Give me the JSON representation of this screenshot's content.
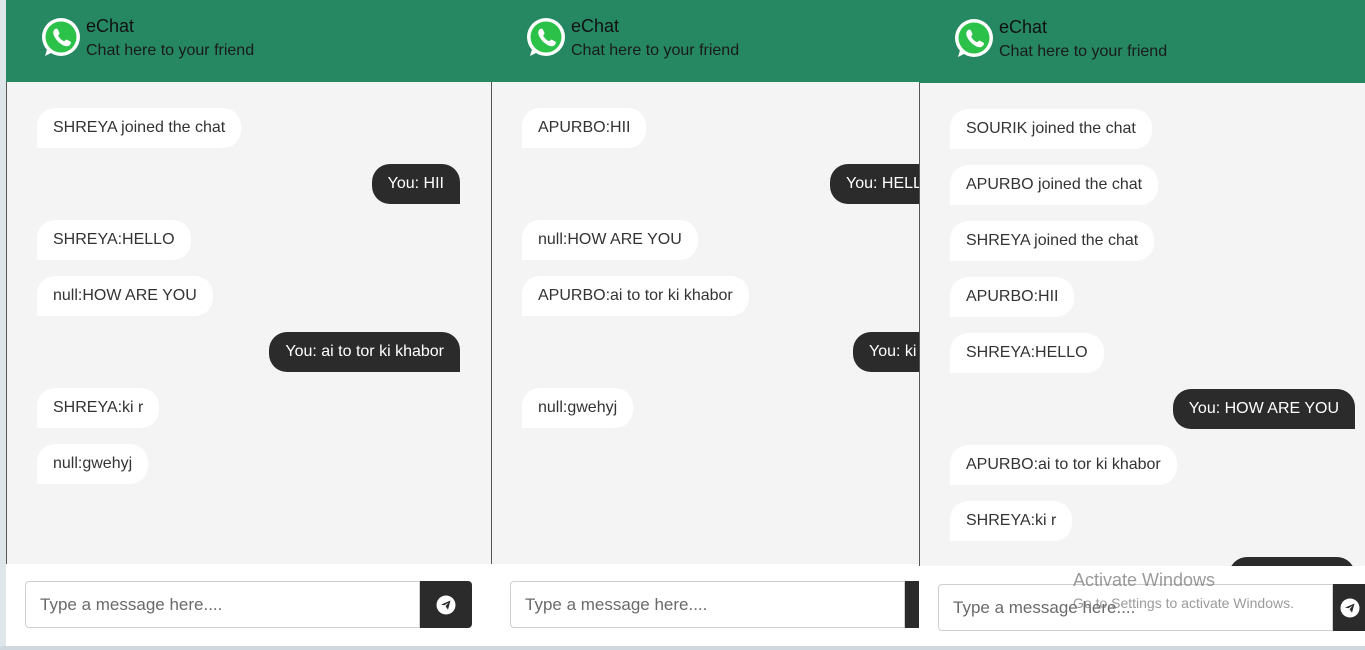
{
  "app": {
    "title": "eChat",
    "subtitle": "Chat here to your friend"
  },
  "colors": {
    "header": "#268763",
    "outgoing": "#2b2b2b",
    "incoming": "#ffffff",
    "background": "#f4f4f4"
  },
  "icons": {
    "logo": "whatsapp-icon",
    "send": "send-icon"
  },
  "panels": [
    {
      "messages": [
        {
          "text": "SHREYA joined the chat",
          "dir": "in"
        },
        {
          "text": "You: HII",
          "dir": "out"
        },
        {
          "text": "SHREYA:HELLO",
          "dir": "in"
        },
        {
          "text": "null:HOW ARE YOU",
          "dir": "in"
        },
        {
          "text": "You: ai to tor ki khabor",
          "dir": "out"
        },
        {
          "text": "SHREYA:ki r",
          "dir": "in"
        },
        {
          "text": "null:gwehyj",
          "dir": "in"
        }
      ],
      "input_placeholder": "Type a message here...."
    },
    {
      "messages": [
        {
          "text": "APURBO:HII",
          "dir": "in"
        },
        {
          "text": "You: HELLO",
          "dir": "out"
        },
        {
          "text": "null:HOW ARE YOU",
          "dir": "in"
        },
        {
          "text": "APURBO:ai to tor ki khabor",
          "dir": "in"
        },
        {
          "text": "You: ki r",
          "dir": "out"
        },
        {
          "text": "null:gwehyj",
          "dir": "in"
        }
      ],
      "input_placeholder": "Type a message here...."
    },
    {
      "messages": [
        {
          "text": "SOURIK joined the chat",
          "dir": "in"
        },
        {
          "text": "APURBO joined the chat",
          "dir": "in"
        },
        {
          "text": "SHREYA joined the chat",
          "dir": "in"
        },
        {
          "text": "APURBO:HII",
          "dir": "in"
        },
        {
          "text": "SHREYA:HELLO",
          "dir": "in"
        },
        {
          "text": "You: HOW ARE YOU",
          "dir": "out"
        },
        {
          "text": "APURBO:ai to tor ki khabor",
          "dir": "in"
        },
        {
          "text": "SHREYA:ki r",
          "dir": "in"
        },
        {
          "text": "",
          "dir": "out"
        }
      ],
      "input_placeholder": "Type a message here...."
    }
  ],
  "watermark": {
    "title": "Activate Windows",
    "subtitle": "Go to Settings to activate Windows."
  }
}
